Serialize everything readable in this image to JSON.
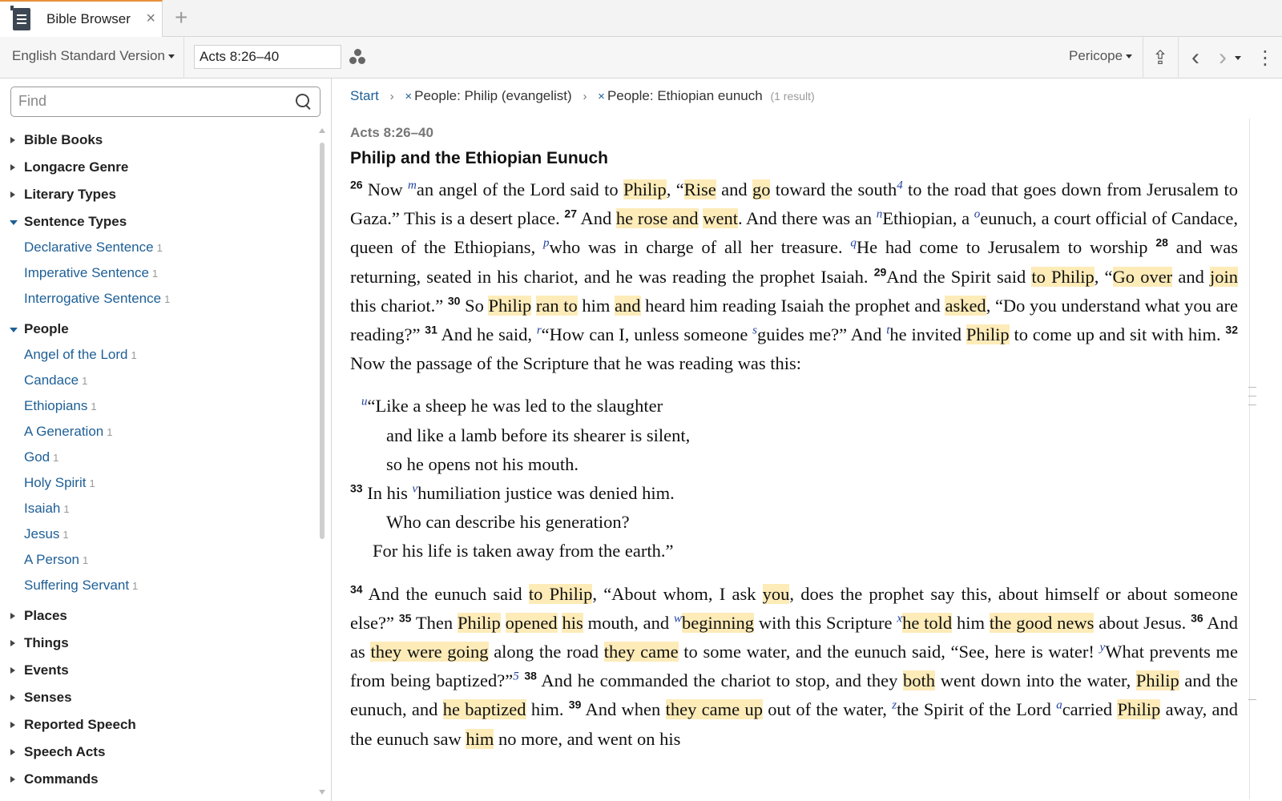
{
  "tab": {
    "title": "Bible Browser",
    "close": "×",
    "add": "+"
  },
  "toolbar": {
    "version": "English Standard Version",
    "reference": "Acts 8:26–40",
    "mode": "Pericope",
    "share": "⇪",
    "back": "‹",
    "forward": "›",
    "more": "⋮"
  },
  "sidebar": {
    "find_placeholder": "Find",
    "categories": [
      {
        "label": "Bible Books"
      },
      {
        "label": "Longacre Genre"
      },
      {
        "label": "Literary Types"
      },
      {
        "label": "Sentence Types",
        "items": [
          {
            "label": "Declarative Sentence",
            "count": "1"
          },
          {
            "label": "Imperative Sentence",
            "count": "1"
          },
          {
            "label": "Interrogative Sentence",
            "count": "1"
          }
        ]
      },
      {
        "label": "People",
        "items": [
          {
            "label": "Angel of the Lord",
            "count": "1"
          },
          {
            "label": "Candace",
            "count": "1"
          },
          {
            "label": "Ethiopians",
            "count": "1"
          },
          {
            "label": "A Generation",
            "count": "1"
          },
          {
            "label": "God",
            "count": "1"
          },
          {
            "label": "Holy Spirit",
            "count": "1"
          },
          {
            "label": "Isaiah",
            "count": "1"
          },
          {
            "label": "Jesus",
            "count": "1"
          },
          {
            "label": "A Person",
            "count": "1"
          },
          {
            "label": "Suffering Servant",
            "count": "1"
          }
        ]
      },
      {
        "label": "Places"
      },
      {
        "label": "Things"
      },
      {
        "label": "Events"
      },
      {
        "label": "Senses"
      },
      {
        "label": "Reported Speech"
      },
      {
        "label": "Speech Acts"
      },
      {
        "label": "Commands"
      }
    ]
  },
  "breadcrumb": {
    "start": "Start",
    "sep": "›",
    "remove": "×",
    "filter1": "People: Philip (evangelist)",
    "filter2": "People: Ethiopian eunuch",
    "result": "(1 result)"
  },
  "passage": {
    "reference": "Acts 8:26–40",
    "title": "Philip and the Ethiopian Eunuch",
    "para1": [
      {
        "t": "26",
        "s": "v"
      },
      {
        "t": " Now "
      },
      {
        "t": "m",
        "s": "f"
      },
      {
        "t": "an angel of the Lord said to "
      },
      {
        "t": "Philip",
        "s": "h"
      },
      {
        "t": ", “"
      },
      {
        "t": "Rise",
        "s": "h"
      },
      {
        "t": " and "
      },
      {
        "t": "go",
        "s": "h"
      },
      {
        "t": " toward the south"
      },
      {
        "t": "4",
        "s": "f"
      },
      {
        "t": " to the road that goes down from Jerusalem to Gaza.” This is a desert place. "
      },
      {
        "t": "27",
        "s": "v"
      },
      {
        "t": " And "
      },
      {
        "t": "he rose and",
        "s": "h"
      },
      {
        "t": " "
      },
      {
        "t": "went",
        "s": "h"
      },
      {
        "t": ". And there was an "
      },
      {
        "t": "n",
        "s": "f"
      },
      {
        "t": "Ethiopian, a "
      },
      {
        "t": "o",
        "s": "f"
      },
      {
        "t": "eunuch, a court official of Candace, queen of the Ethiopians, "
      },
      {
        "t": "p",
        "s": "f"
      },
      {
        "t": "who was in charge of all her treasure. "
      },
      {
        "t": "q",
        "s": "f"
      },
      {
        "t": "He had come to Jerusalem to worship "
      },
      {
        "t": "28",
        "s": "v"
      },
      {
        "t": " and was returning, seated in his chariot, and he was reading the prophet Isaiah. "
      },
      {
        "t": "29",
        "s": "v"
      },
      {
        "t": "And the Spirit said "
      },
      {
        "t": "to Philip",
        "s": "h"
      },
      {
        "t": ", “"
      },
      {
        "t": "Go over",
        "s": "h"
      },
      {
        "t": " and "
      },
      {
        "t": "join",
        "s": "h"
      },
      {
        "t": " this chariot.” "
      },
      {
        "t": "30",
        "s": "v"
      },
      {
        "t": " So "
      },
      {
        "t": "Philip",
        "s": "h"
      },
      {
        "t": " "
      },
      {
        "t": "ran to",
        "s": "h"
      },
      {
        "t": " him "
      },
      {
        "t": "and",
        "s": "h"
      },
      {
        "t": " heard him reading Isaiah the prophet and "
      },
      {
        "t": "asked",
        "s": "h"
      },
      {
        "t": ", “Do you understand what you are reading?” "
      },
      {
        "t": "31",
        "s": "v"
      },
      {
        "t": " And he said, "
      },
      {
        "t": "r",
        "s": "f"
      },
      {
        "t": "“How can I, unless someone "
      },
      {
        "t": "s",
        "s": "f"
      },
      {
        "t": "guides me?” And "
      },
      {
        "t": "t",
        "s": "f"
      },
      {
        "t": "he invited "
      },
      {
        "t": "Philip",
        "s": "h"
      },
      {
        "t": " to come up and sit with him. "
      },
      {
        "t": "32",
        "s": "v"
      },
      {
        "t": " Now the passage of the Scripture that he was reading was this:"
      }
    ],
    "poetry": [
      {
        "indent": "i1",
        "parts": [
          {
            "t": "u",
            "s": "f"
          },
          {
            "t": "“Like a sheep he was led to the slaughter"
          }
        ]
      },
      {
        "indent": "i2",
        "parts": [
          {
            "t": "and like a lamb before its shearer is silent,"
          }
        ]
      },
      {
        "indent": "i2",
        "parts": [
          {
            "t": "so he opens not his mouth."
          }
        ]
      },
      {
        "indent": "i0",
        "parts": [
          {
            "t": "33",
            "s": "v"
          },
          {
            "t": "  In his "
          },
          {
            "t": "v",
            "s": "f"
          },
          {
            "t": "humiliation justice was denied him."
          }
        ]
      },
      {
        "indent": "i2",
        "parts": [
          {
            "t": "Who can describe his generation?"
          }
        ]
      },
      {
        "indent": "i3",
        "parts": [
          {
            "t": "For his life is taken away from the earth.”"
          }
        ]
      }
    ],
    "para2": [
      {
        "t": "34",
        "s": "v"
      },
      {
        "t": " And the eunuch said "
      },
      {
        "t": "to Philip",
        "s": "h"
      },
      {
        "t": ", “About whom, I ask "
      },
      {
        "t": "you",
        "s": "h"
      },
      {
        "t": ", does the prophet say this, about himself or about someone else?” "
      },
      {
        "t": "35",
        "s": "v"
      },
      {
        "t": " Then "
      },
      {
        "t": "Philip",
        "s": "h"
      },
      {
        "t": " "
      },
      {
        "t": "opened",
        "s": "h"
      },
      {
        "t": " "
      },
      {
        "t": "his",
        "s": "h"
      },
      {
        "t": " mouth, and "
      },
      {
        "t": "w",
        "s": "f"
      },
      {
        "t": "beginning",
        "s": "h"
      },
      {
        "t": " with this Scripture "
      },
      {
        "t": "x",
        "s": "f"
      },
      {
        "t": "he told",
        "s": "h"
      },
      {
        "t": " him "
      },
      {
        "t": "the good news",
        "s": "h"
      },
      {
        "t": " about Jesus. "
      },
      {
        "t": "36",
        "s": "v"
      },
      {
        "t": " And as "
      },
      {
        "t": "they were going",
        "s": "h"
      },
      {
        "t": " along the road "
      },
      {
        "t": "they came",
        "s": "h"
      },
      {
        "t": " to some water, and the eunuch said, “See, here is water! "
      },
      {
        "t": "y",
        "s": "f"
      },
      {
        "t": "What prevents me from being baptized?”"
      },
      {
        "t": "5",
        "s": "f"
      },
      {
        "t": " "
      },
      {
        "t": "38",
        "s": "v"
      },
      {
        "t": " And he commanded the chariot to stop, and they "
      },
      {
        "t": "both",
        "s": "h"
      },
      {
        "t": " went down into the water, "
      },
      {
        "t": "Philip",
        "s": "h"
      },
      {
        "t": " and the eunuch, and "
      },
      {
        "t": "he baptized",
        "s": "h"
      },
      {
        "t": " him. "
      },
      {
        "t": "39",
        "s": "v"
      },
      {
        "t": " And when "
      },
      {
        "t": "they came up",
        "s": "h"
      },
      {
        "t": " out of the water, "
      },
      {
        "t": "z",
        "s": "f"
      },
      {
        "t": "the Spirit of the Lord "
      },
      {
        "t": "a",
        "s": "f"
      },
      {
        "t": "carried "
      },
      {
        "t": "Philip",
        "s": "h"
      },
      {
        "t": " away, and the eunuch saw "
      },
      {
        "t": "him",
        "s": "h"
      },
      {
        "t": " no more, and went on his"
      }
    ]
  }
}
